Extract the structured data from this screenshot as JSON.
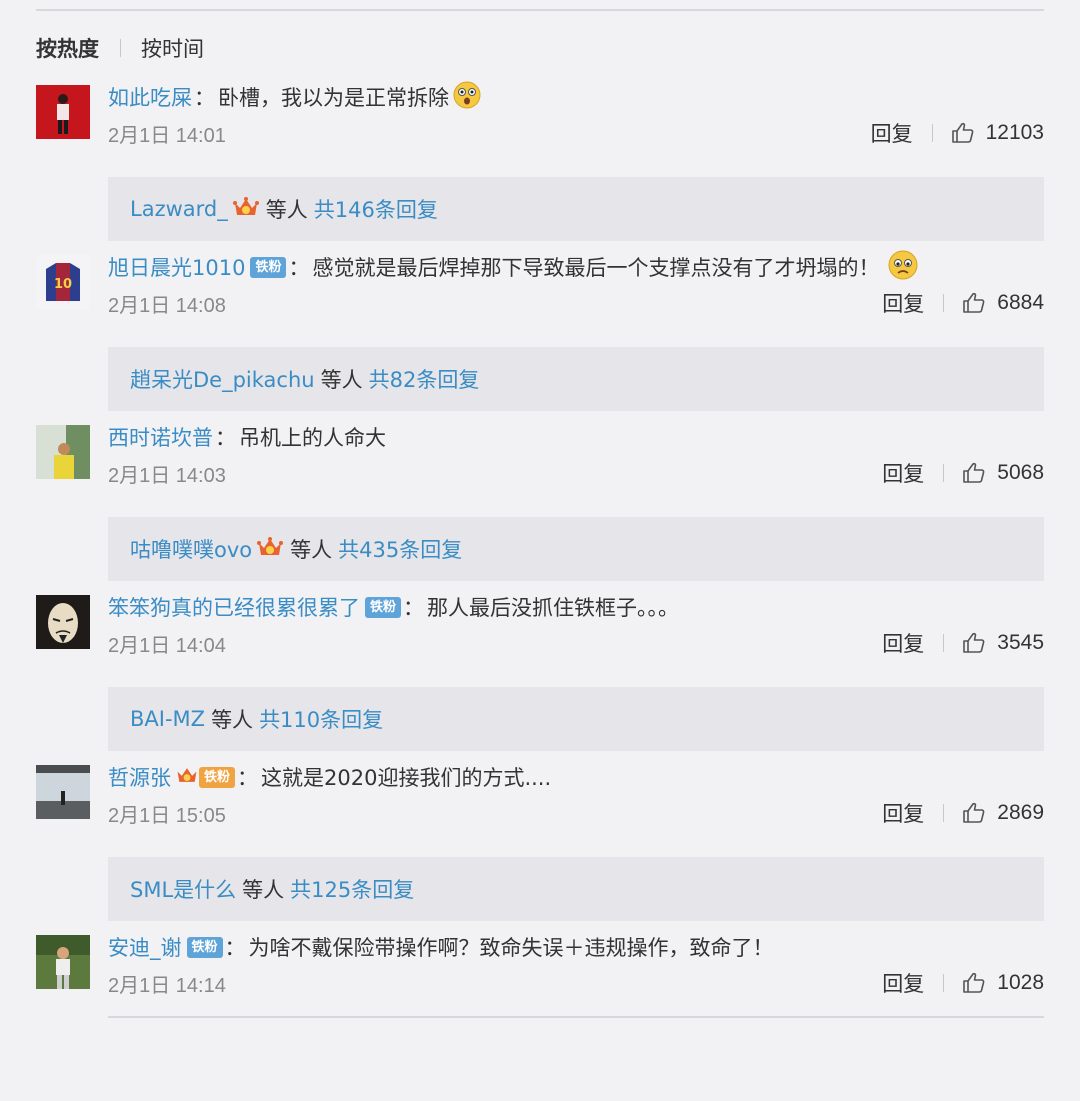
{
  "sort": {
    "hot_label": "按热度",
    "time_label": "按时间"
  },
  "comments": [
    {
      "username": "如此吃屎",
      "colon": "：",
      "text": "卧槽，我以为是正常拆除",
      "emoji": "shocked-emoji",
      "date": "2月1日 14:01",
      "reply_label": "回复",
      "likes": "12103",
      "replies": {
        "user": "Lazward_",
        "others": "等人",
        "total": "共146条回复"
      }
    },
    {
      "username": "旭日晨光1010",
      "badge": "铁粉",
      "colon": "：",
      "text": "感觉就是最后焊掉那下导致最后一个支撑点没有了才坍塌的！",
      "emoji": "worried-emoji",
      "date": "2月1日 14:08",
      "reply_label": "回复",
      "likes": "6884",
      "replies": {
        "user": "趙呆光De_pikachu",
        "others": "等人",
        "total": "共82条回复"
      }
    },
    {
      "username": "西时诺坎普",
      "colon": "：",
      "text": "吊机上的人命大",
      "date": "2月1日 14:03",
      "reply_label": "回复",
      "likes": "5068",
      "replies": {
        "user": "咕噜噗噗ovo",
        "others": "等人",
        "total": "共435条回复"
      }
    },
    {
      "username": "笨笨狗真的已经很累很累了",
      "badge": "铁粉",
      "colon": "：",
      "text": "那人最后没抓住铁框子。。。",
      "date": "2月1日 14:04",
      "reply_label": "回复",
      "likes": "3545",
      "replies": {
        "user": "BAI-MZ",
        "others": "等人",
        "total": "共110条回复"
      }
    },
    {
      "username": "哲源张",
      "badge": "铁粉",
      "colon": "：",
      "text": "这就是2020迎接我们的方式....",
      "date": "2月1日 15:05",
      "reply_label": "回复",
      "likes": "2869",
      "replies": {
        "user": "SML是什么",
        "others": "等人",
        "total": "共125条回复"
      }
    },
    {
      "username": "安迪_谢",
      "badge": "铁粉",
      "colon": "：",
      "text": "为啥不戴保险带操作啊？致命失误＋违规操作，致命了！",
      "date": "2月1日 14:14",
      "reply_label": "回复",
      "likes": "1028"
    }
  ],
  "colors": {
    "link": "#3a8cc4",
    "badge": "#5fa4d9",
    "background": "#f2f2f5",
    "reply_box": "#e6e6ea",
    "crown": "#e8632f"
  }
}
